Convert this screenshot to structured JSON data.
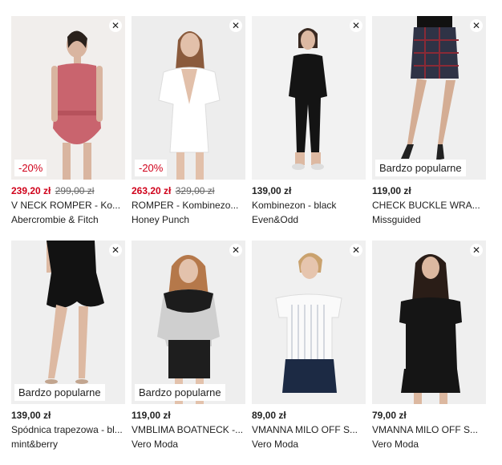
{
  "products": [
    {
      "price": "239,20 zł",
      "old_price": "299,00 zł",
      "name": "V NECK ROMPER - Ko...",
      "brand": "Abercrombie & Fitch",
      "badge": "-20%",
      "close": "✕"
    },
    {
      "price": "263,20 zł",
      "old_price": "329,00 zł",
      "name": "ROMPER - Kombinezo...",
      "brand": "Honey Punch",
      "badge": "-20%",
      "close": "✕"
    },
    {
      "price": "139,00 zł",
      "old_price": "",
      "name": "Kombinezon - black",
      "brand": "Even&Odd",
      "badge": "",
      "close": "✕"
    },
    {
      "price": "119,00 zł",
      "old_price": "",
      "name": "CHECK BUCKLE WRA...",
      "brand": "Missguided",
      "badge": "Bardzo popularne",
      "close": "✕"
    },
    {
      "price": "139,00 zł",
      "old_price": "",
      "name": "Spódnica trapezowa - bl...",
      "brand": "mint&berry",
      "badge": "Bardzo popularne",
      "close": "✕"
    },
    {
      "price": "119,00 zł",
      "old_price": "",
      "name": "VMBLIMA BOATNECK -...",
      "brand": "Vero Moda",
      "badge": "Bardzo popularne",
      "close": "✕"
    },
    {
      "price": "89,00 zł",
      "old_price": "",
      "name": "VMANNA MILO OFF S...",
      "brand": "Vero Moda",
      "badge": "",
      "close": "✕"
    },
    {
      "price": "79,00 zł",
      "old_price": "",
      "name": "VMANNA MILO OFF S...",
      "brand": "Vero Moda",
      "badge": "",
      "close": "✕"
    }
  ],
  "colors": {
    "sale_red": "#d0021b",
    "image_bg": "#ededed"
  }
}
